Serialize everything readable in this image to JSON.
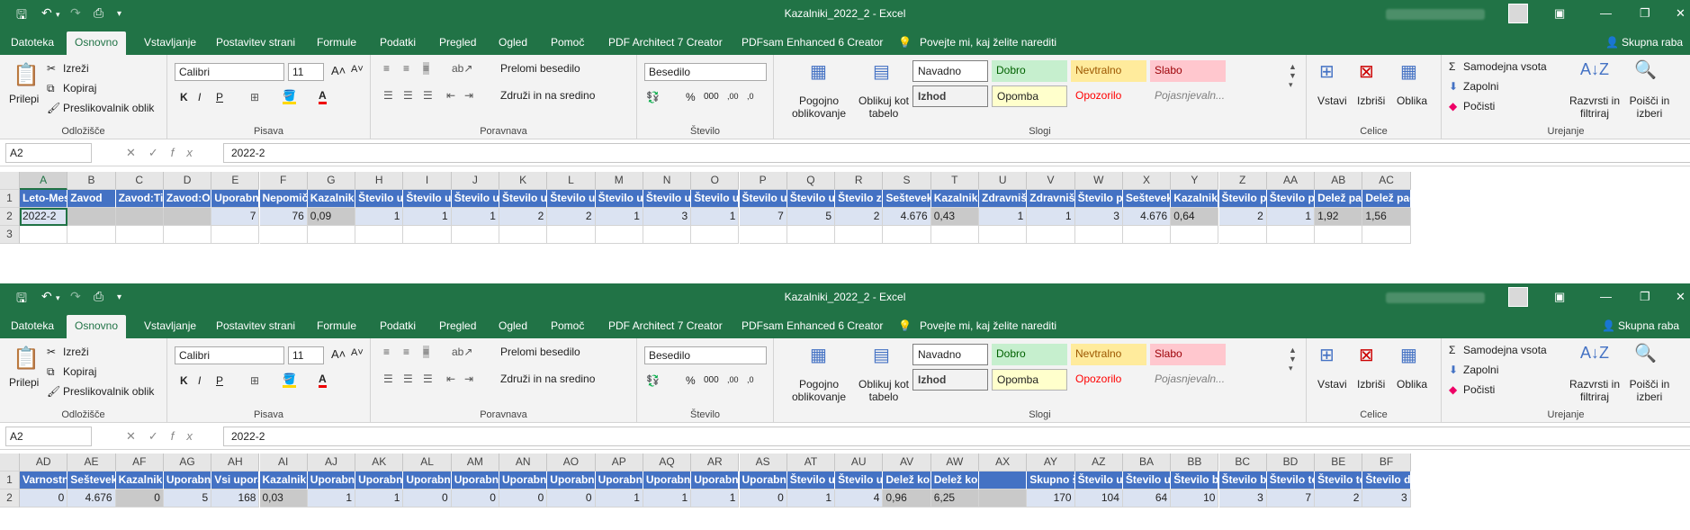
{
  "window1": {
    "title": "Kazalniki_2022_2  -  Excel",
    "menu": [
      "Datoteka",
      "Osnovno",
      "Vstavljanje",
      "Postavitev strani",
      "Formule",
      "Podatki",
      "Pregled",
      "Ogled",
      "Pomoč",
      "PDF Architect 7 Creator",
      "PDFsam Enhanced 6 Creator"
    ],
    "tell_me": "Povejte mi, kaj želite narediti",
    "share": "Skupna raba",
    "ribbon": {
      "paste": "Prilepi",
      "cut": "Izreži",
      "copy": "Kopiraj",
      "format_painter": "Preslikovalnik oblik",
      "clipboard": "Odložišče",
      "font_name": "Calibri",
      "font_size": "11",
      "font": "Pisava",
      "wrap": "Prelomi besedilo",
      "merge": "Združi in na sredino",
      "alignment": "Poravnava",
      "number_format": "Besedilo",
      "number": "Število",
      "cond_format": "Pogojno oblikovanje",
      "format_table": "Oblikuj kot tabelo",
      "styles": [
        "Navadno",
        "Dobro",
        "Nevtralno",
        "Slabo",
        "Izhod",
        "Opomba",
        "Opozorilo",
        "Pojasnjevaln..."
      ],
      "styles_label": "Slogi",
      "insert": "Vstavi",
      "delete": "Izbriši",
      "format": "Oblika",
      "cells": "Celice",
      "autosum": "Samodejna vsota",
      "fill": "Zapolni",
      "clear": "Počisti",
      "sort": "Razvrsti in filtriraj",
      "find": "Poišči in izberi",
      "editing": "Urejanje"
    },
    "namebox": "A2",
    "formula": "2022-2",
    "columns": [
      "A",
      "B",
      "C",
      "D",
      "E",
      "F",
      "G",
      "H",
      "I",
      "J",
      "K",
      "L",
      "M",
      "N",
      "O",
      "P",
      "Q",
      "R",
      "S",
      "T",
      "U",
      "V",
      "W",
      "X",
      "Y",
      "Z",
      "AA",
      "AB",
      "AC"
    ],
    "headers": [
      "Leto-Mes",
      "Zavod",
      "Zavod:Tip",
      "Zavod:Ob",
      "Uporabnil",
      "Nepomičn",
      "Kazalnik 1",
      "Število up",
      "Število up",
      "Število up",
      "Število up",
      "Število up",
      "Število up",
      "Število up",
      "Število up",
      "Število up",
      "Število up",
      "Število zd",
      "Seštevek",
      "Kazalnik 2",
      "Zdravnišk",
      "Zdravnišk",
      "Število pa",
      "Seštevek",
      "Kazalnik 3",
      "Število pa",
      "Število pa",
      "Delež pad",
      "Delež pad"
    ],
    "values": [
      "2022-2",
      "",
      "",
      "",
      "7",
      "76",
      "0,09",
      "1",
      "1",
      "1",
      "2",
      "2",
      "1",
      "3",
      "1",
      "7",
      "5",
      "2",
      "4.676",
      "0,43",
      "1",
      "1",
      "3",
      "4.676",
      "0,64",
      "2",
      "1",
      "1,92",
      "1,56"
    ],
    "rows": [
      "1",
      "2",
      "3"
    ]
  },
  "window2": {
    "title": "Kazalniki_2022_2  -  Excel",
    "namebox": "A2",
    "formula": "2022-2",
    "columns": [
      "AD",
      "AE",
      "AF",
      "AG",
      "AH",
      "AI",
      "AJ",
      "AK",
      "AL",
      "AM",
      "AN",
      "AO",
      "AP",
      "AQ",
      "AR",
      "AS",
      "AT",
      "AU",
      "AV",
      "AW",
      "AX",
      "AY",
      "AZ",
      "BA",
      "BB",
      "BC",
      "BD",
      "BE",
      "BF"
    ],
    "headers": [
      "Varnostni",
      "Seštevek",
      "Kazalnik 4",
      "Uporabnil",
      "Vsi upora",
      "Kazalnik 5",
      "Uporabnil",
      "Uporabnil",
      "Uporabnil",
      "Uporabnil",
      "Uporabnil",
      "Uporabnil",
      "Uporabnil",
      "Uporabnil",
      "Uporabnil",
      "Uporabnil",
      "Število up",
      "Število up",
      "Delež kol",
      "Delež kol",
      "",
      "Skupno št",
      "Število up",
      "Število up",
      "Število bo",
      "Število bo",
      "Število te",
      "Število te",
      "Število di"
    ],
    "values": [
      "0",
      "4.676",
      "0",
      "5",
      "168",
      "0,03",
      "1",
      "1",
      "0",
      "0",
      "0",
      "0",
      "1",
      "1",
      "1",
      "0",
      "1",
      "4",
      "0,96",
      "6,25",
      "",
      "170",
      "104",
      "64",
      "10",
      "3",
      "7",
      "2",
      "3"
    ],
    "rows": [
      "1",
      "2"
    ]
  },
  "colors": {
    "excel_green": "#217346",
    "header_blue": "#4472c4",
    "data_blue": "#dbe3f2"
  }
}
